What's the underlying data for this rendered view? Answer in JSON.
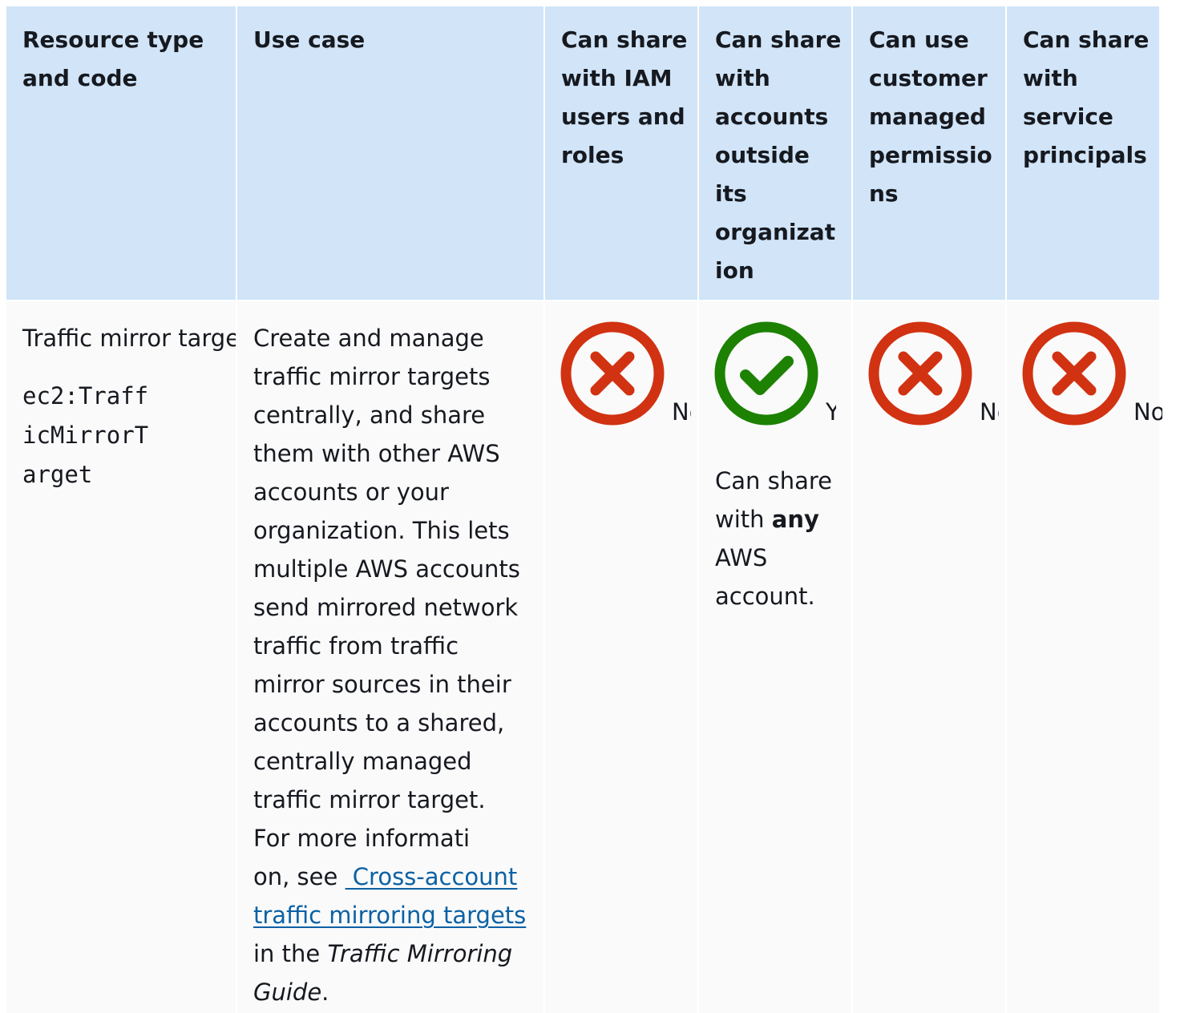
{
  "header": {
    "col1": [
      "Resource type",
      "and code"
    ],
    "col2": [
      "Use case"
    ],
    "col3": [
      "Can share",
      "with IAM",
      "users and",
      "roles"
    ],
    "col4": [
      "Can share",
      "with",
      "accounts",
      "outside",
      "its",
      "organizat",
      "ion"
    ],
    "col5": [
      "Can use",
      "customer",
      "managed",
      "permissio",
      "ns"
    ],
    "col6": [
      "Can share",
      "with",
      "service",
      "principals"
    ]
  },
  "row": {
    "resource_type": "Traffic mirror target",
    "code_lines": [
      "ec2:Traff",
      "icMirrorT",
      "arget"
    ],
    "use_case": {
      "lines": [
        "Create and manage",
        "traffic mirror targets",
        "centrally, and share",
        "them with other AWS",
        "accounts or your",
        "organization. This lets",
        "multiple AWS accounts",
        "send mirrored network",
        "traffic from traffic",
        "mirror sources in their",
        "accounts to a shared,",
        "centrally managed",
        "traffic mirror target.",
        "For more informati"
      ],
      "see_prefix": "on, see ",
      "link_line1": " Cross-account",
      "link_line2": "traffic mirroring targets",
      "in_the": "in the ",
      "guide_italic_1": "Traffic Mirroring",
      "guide_italic_2": "Guide",
      "end": "."
    },
    "iam_users_roles": {
      "icon": "error-x-icon",
      "text": "No"
    },
    "outside_org": {
      "icon": "success-check-icon",
      "text": "Yes",
      "note_1": "Can share",
      "note_2_pre": "with ",
      "note_2_bold": "any",
      "note_3": "AWS",
      "note_4": "account."
    },
    "customer_managed": {
      "icon": "error-x-icon",
      "text": "No"
    },
    "service_principals": {
      "icon": "error-x-icon",
      "text": "No"
    }
  },
  "colors": {
    "header_bg": "#d1e4f8",
    "row_bg": "#fafafa",
    "error_red": "#d13212",
    "success_green": "#1d8102",
    "link_blue": "#0b61a4"
  }
}
